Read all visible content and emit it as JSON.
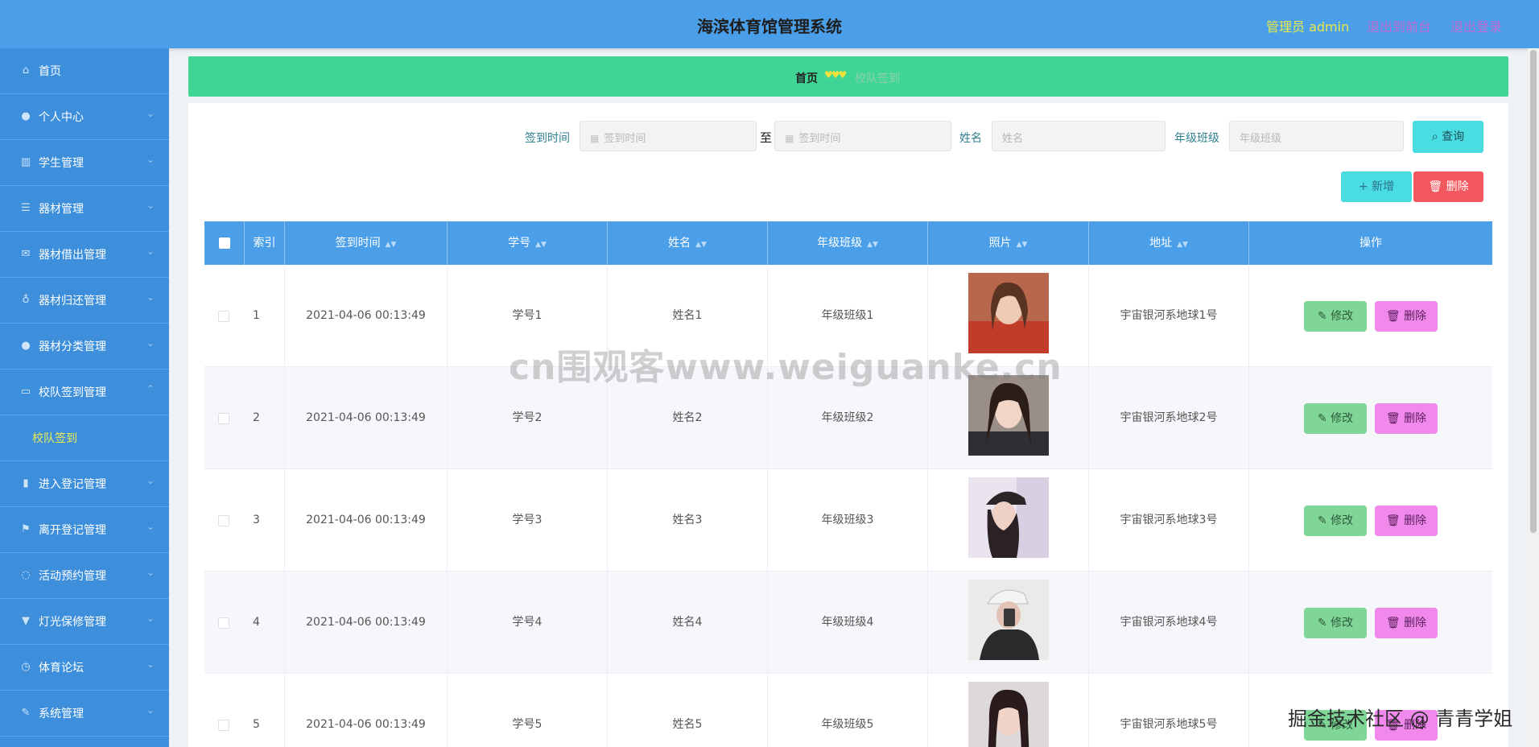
{
  "header": {
    "title": "海滨体育馆管理系统",
    "admin": "管理员 admin",
    "front_link": "退出到前台",
    "logout_link": "退出登录"
  },
  "sidebar": {
    "items": [
      {
        "label": "首页",
        "icon": "home-icon",
        "arrow": false
      },
      {
        "label": "个人中心",
        "icon": "user-icon",
        "arrow": true
      },
      {
        "label": "学生管理",
        "icon": "student-icon",
        "arrow": true
      },
      {
        "label": "器材管理",
        "icon": "equipment-icon",
        "arrow": true
      },
      {
        "label": "器材借出管理",
        "icon": "mail-icon",
        "arrow": true
      },
      {
        "label": "器材归还管理",
        "icon": "microphone-icon",
        "arrow": true
      },
      {
        "label": "器材分类管理",
        "icon": "user-icon",
        "arrow": true
      },
      {
        "label": "校队签到管理",
        "icon": "chat-icon",
        "arrow": true,
        "expanded": true
      },
      {
        "label": "进入登记管理",
        "icon": "bar-chart-icon",
        "arrow": true
      },
      {
        "label": "离开登记管理",
        "icon": "flag-icon",
        "arrow": true
      },
      {
        "label": "活动预约管理",
        "icon": "refresh-icon",
        "arrow": true
      },
      {
        "label": "灯光保修管理",
        "icon": "trophy-icon",
        "arrow": true
      },
      {
        "label": "体育论坛",
        "icon": "forum-icon",
        "arrow": true
      },
      {
        "label": "系统管理",
        "icon": "settings-icon",
        "arrow": true
      }
    ],
    "submenu": "校队签到"
  },
  "breadcrumb": {
    "home": "首页",
    "separator": "♥♥♥",
    "current": "校队签到"
  },
  "filters": {
    "sign_time_label": "签到时间",
    "start_placeholder": "签到时间",
    "to": "至",
    "end_placeholder": "签到时间",
    "name_label": "姓名",
    "name_placeholder": "姓名",
    "class_label": "年级班级",
    "class_placeholder": "年级班级",
    "query_button": "查询"
  },
  "actions": {
    "add": "新增",
    "delete": "删除"
  },
  "table": {
    "columns": [
      "索引",
      "签到时间",
      "学号",
      "姓名",
      "年级班级",
      "照片",
      "地址",
      "操作"
    ],
    "edit_label": "修改",
    "delete_label": "删除",
    "rows": [
      {
        "index": "1",
        "time": "2021-04-06 00:13:49",
        "student_no": "学号1",
        "name": "姓名1",
        "class": "年级班级1",
        "address": "宇宙银河系地球1号"
      },
      {
        "index": "2",
        "time": "2021-04-06 00:13:49",
        "student_no": "学号2",
        "name": "姓名2",
        "class": "年级班级2",
        "address": "宇宙银河系地球2号"
      },
      {
        "index": "3",
        "time": "2021-04-06 00:13:49",
        "student_no": "学号3",
        "name": "姓名3",
        "class": "年级班级3",
        "address": "宇宙银河系地球3号"
      },
      {
        "index": "4",
        "time": "2021-04-06 00:13:49",
        "student_no": "学号4",
        "name": "姓名4",
        "class": "年级班级4",
        "address": "宇宙银河系地球4号"
      },
      {
        "index": "5",
        "time": "2021-04-06 00:13:49",
        "student_no": "学号5",
        "name": "姓名5",
        "class": "年级班级5",
        "address": "宇宙银河系地球5号"
      }
    ]
  },
  "watermarks": {
    "center": "cn围观客www.weiguanke.cn",
    "corner": "掘金技术社区 @ 青青学姐"
  }
}
